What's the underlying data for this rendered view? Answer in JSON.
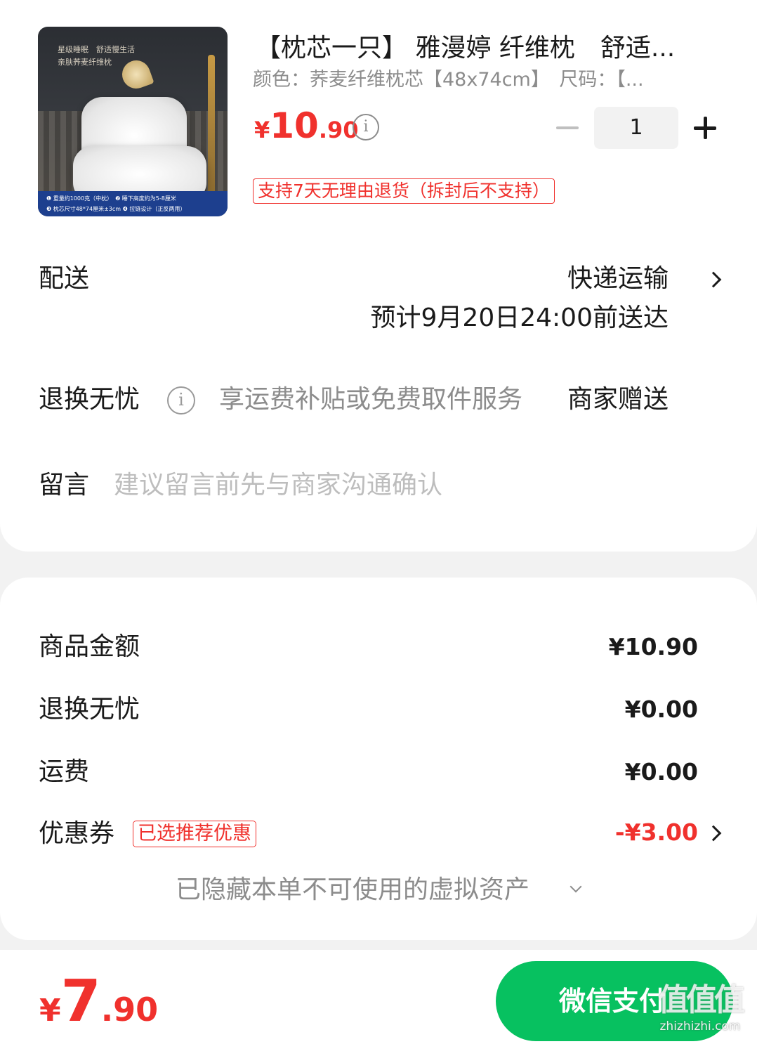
{
  "product": {
    "title": "【枕芯一只】 雅漫婷 纤维枕　舒适...",
    "spec": "颜色：荞麦纤维枕芯【48x74cm】　尺码：【...",
    "price_currency": "¥",
    "price_int": "10",
    "price_dec": ".90",
    "quantity": "1",
    "return_policy": "支持7天无理由退货（拆封后不支持）",
    "image": {
      "tagline_1": "星级睡眠　舒适慢生活",
      "tagline_2": "亲肤荞麦纤维枕",
      "band_1": "❶ 重量约1000克（中枕）　❷ 睡下高度约为5-8厘米",
      "band_2": "❸ 枕芯尺寸48*74厘米±3cm ❹ 拉链设计（正反两用）"
    }
  },
  "delivery": {
    "label": "配送",
    "method": "快递运输",
    "eta": "预计9月20日24:00前送达"
  },
  "worry_free": {
    "label": "退换无忧",
    "desc": "享运费补贴或免费取件服务",
    "value": "商家赠送"
  },
  "message": {
    "label": "留言",
    "placeholder": "建议留言前先与商家沟通确认"
  },
  "summary": {
    "goods_label": "商品金额",
    "goods_value": "¥10.90",
    "worry_free_label": "退换无忧",
    "worry_free_value": "¥0.00",
    "shipping_label": "运费",
    "shipping_value": "¥0.00",
    "coupon_label": "优惠券",
    "coupon_tag": "已选推荐优惠",
    "coupon_value": "-¥3.00",
    "hidden_assets": "已隐藏本单不可使用的虚拟资产"
  },
  "total": {
    "currency": "¥",
    "int": "7",
    "dec": ".90"
  },
  "pay_button": "微信支付",
  "watermark": {
    "big": "值值值",
    "small": "zhizhizhi.com"
  },
  "colors": {
    "accent_red": "#f0312d",
    "wechat_green": "#07c160",
    "muted_gray": "#8c8c8c"
  }
}
